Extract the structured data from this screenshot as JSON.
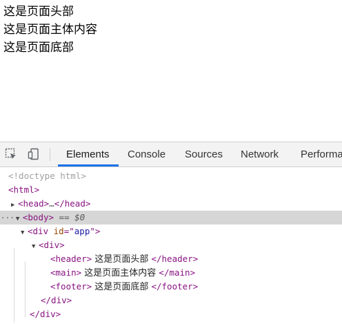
{
  "page": {
    "lines": [
      "这是页面头部",
      "这是页面主体内容",
      "这是页面底部"
    ]
  },
  "devtools": {
    "tool_icons": [
      "inspect-element-icon",
      "device-toolbar-icon"
    ],
    "tabs": [
      "Elements",
      "Console",
      "Sources",
      "Network",
      "Performa"
    ],
    "active_tab": "Elements",
    "dom": {
      "doctype": "<!doctype html>",
      "html_open": "<html>",
      "head_open": "<head>",
      "head_ellipsis": "…",
      "head_close": "</head>",
      "body_dots": "···",
      "body_open": "<body>",
      "body_ref": " == $0",
      "div_app_open": "<div",
      "div_app_attr_name": "id",
      "div_app_attr_eq": "=\"",
      "div_app_attr_value": "app",
      "div_app_attr_close": "\">",
      "div_open": "<div>",
      "header_open": "<header>",
      "header_text": " 这是页面头部 ",
      "header_close": "</header>",
      "main_open": "<main>",
      "main_text": " 这是页面主体内容 ",
      "main_close": "</main>",
      "footer_open": "<footer>",
      "footer_text": " 这是页面底部 ",
      "footer_close": "</footer>",
      "div_close": "</div>",
      "div_app_close": "</div>"
    }
  }
}
